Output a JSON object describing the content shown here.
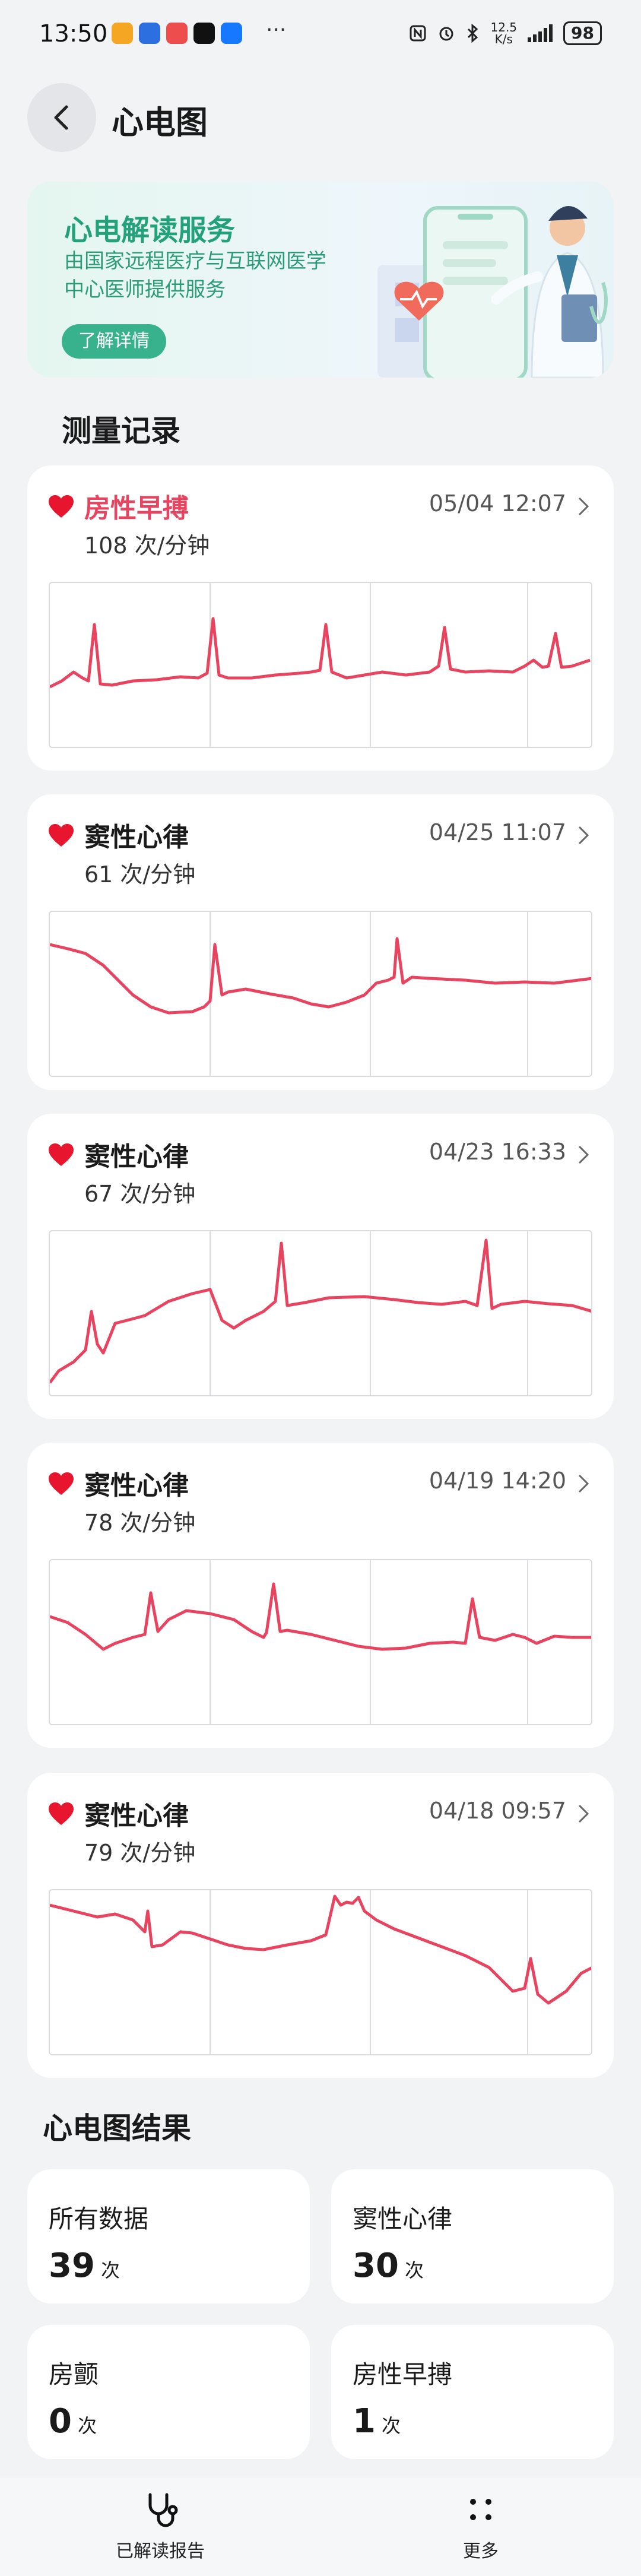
{
  "status_bar": {
    "time": "13:50",
    "more": "···",
    "net_speed_value": "12.5",
    "net_speed_unit": "K/s",
    "battery": "98",
    "icons": [
      "nfc-icon",
      "alarm-icon",
      "bluetooth-icon",
      "signal-icon",
      "battery-icon"
    ]
  },
  "header": {
    "title": "心电图",
    "back_icon": "back-arrow-icon"
  },
  "banner": {
    "title": "心电解读服务",
    "subtitle_line1": "由国家远程医疗与互联网医学",
    "subtitle_line2": "中心医师提供服务",
    "button": "了解详情",
    "accent": "#23a17a"
  },
  "records": {
    "title": "测量记录",
    "items": [
      {
        "type": "房性早搏",
        "time": "05/04 12:07",
        "rate": "108 次/分钟",
        "alert": true
      },
      {
        "type": "窦性心律",
        "time": "04/25 11:07",
        "rate": "61 次/分钟",
        "alert": false
      },
      {
        "type": "窦性心律",
        "time": "04/23 16:33",
        "rate": "67 次/分钟",
        "alert": false
      },
      {
        "type": "窦性心律",
        "time": "04/19 14:20",
        "rate": "78 次/分钟",
        "alert": false
      },
      {
        "type": "窦性心律",
        "time": "04/18 09:57",
        "rate": "79 次/分钟",
        "alert": false
      }
    ]
  },
  "results": {
    "title": "心电图结果",
    "unit": "次",
    "tiles": [
      {
        "label": "所有数据",
        "value": "39"
      },
      {
        "label": "窦性心律",
        "value": "30"
      },
      {
        "label": "房颤",
        "value": "0"
      },
      {
        "label": "房性早搏",
        "value": "1"
      }
    ]
  },
  "bottom_nav": {
    "items": [
      {
        "label": "已解读报告",
        "icon": "stethoscope-icon"
      },
      {
        "label": "更多",
        "icon": "more-dots-icon"
      }
    ]
  },
  "colors": {
    "ecg_line": "#e8435f",
    "alert_text": "#e8435f",
    "heart": "#e8152e"
  }
}
